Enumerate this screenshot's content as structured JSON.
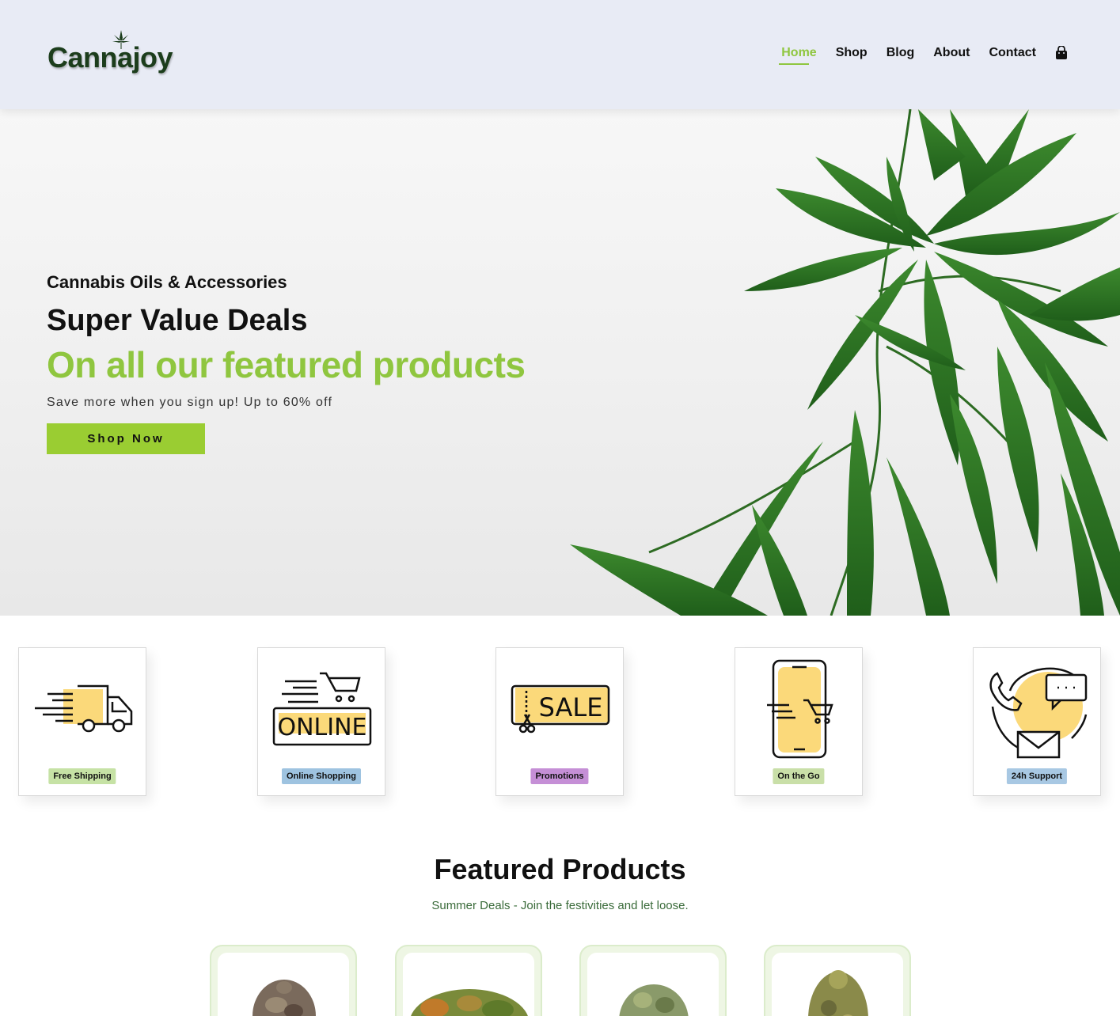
{
  "brand": {
    "name": "Cannajoy",
    "accent": "#8fc63f",
    "button": "#9acd32",
    "header_bg": "#e8ebf5"
  },
  "nav": {
    "items": [
      {
        "label": "Home",
        "active": true
      },
      {
        "label": "Shop",
        "active": false
      },
      {
        "label": "Blog",
        "active": false
      },
      {
        "label": "About",
        "active": false
      },
      {
        "label": "Contact",
        "active": false
      }
    ],
    "cart_icon": "shopping-bag-icon"
  },
  "hero": {
    "eyebrow": "Cannabis Oils & Accessories",
    "title": "Super Value Deals",
    "subtitle": "On all our featured products",
    "description": "Save more when you sign up! Up to 60% off",
    "button": "Shop Now"
  },
  "features": [
    {
      "label": "Free Shipping",
      "icon": "delivery-truck-icon",
      "tag_color": "#c6e2a5"
    },
    {
      "label": "Online Shopping",
      "icon": "online-cart-icon",
      "tag_color": "#9ec3e0"
    },
    {
      "label": "Promotions",
      "icon": "sale-coupon-icon",
      "tag_color": "#c58fd6"
    },
    {
      "label": "On the Go",
      "icon": "mobile-shopping-icon",
      "tag_color": "#c9dfa8"
    },
    {
      "label": "24h Support",
      "icon": "support-phone-icon",
      "tag_color": "#a8c8e3"
    }
  ],
  "featured": {
    "title": "Featured Products",
    "subtitle": "Summer Deals - Join the festivities and let loose."
  }
}
